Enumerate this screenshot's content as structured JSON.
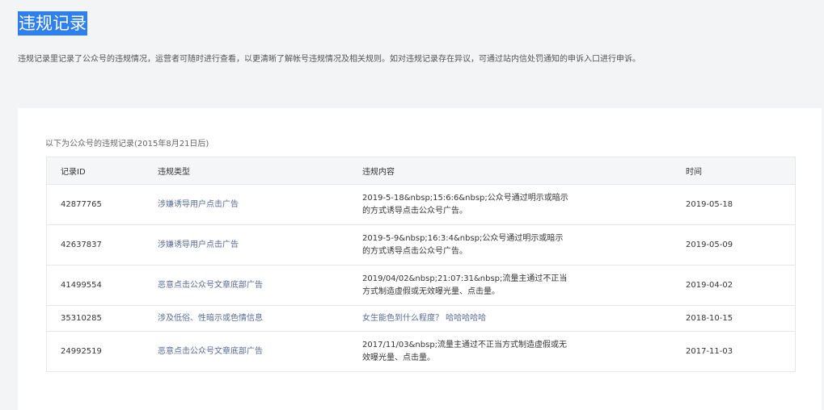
{
  "header": {
    "title": "违规记录",
    "description": "违规记录里记录了公众号的违规情况，运营者可随时进行查看，以更清晰了解帐号违规情况及相关规则。如对违规记录存在异议，可通过站内信处罚通知的申诉入口进行申诉。"
  },
  "records": {
    "caption": "以下为公众号的违规记录(2015年8月21日后)",
    "columns": {
      "id": "记录ID",
      "type": "违规类型",
      "content": "违规内容",
      "time": "时间"
    },
    "rows": [
      {
        "id": "42877765",
        "type": "涉嫌诱导用户点击广告",
        "content": "2019-5-18&nbsp;15:6:6&nbsp;公众号通过明示或暗示的方式诱导点击公众号广告。",
        "time": "2019-05-18"
      },
      {
        "id": "42637837",
        "type": "涉嫌诱导用户点击广告",
        "content": "2019-5-9&nbsp;16:3:4&nbsp;公众号通过明示或暗示的方式诱导点击公众号广告。",
        "time": "2019-05-09"
      },
      {
        "id": "41499554",
        "type": "恶意点击公众号文章底部广告",
        "content": "2019/04/02&nbsp;21:07:31&nbsp;流量主通过不正当方式制造虚假或无效曝光量、点击量。",
        "time": "2019-04-02"
      },
      {
        "id": "35310285",
        "type": "涉及低俗、性暗示或色情信息",
        "content": "女生能色到什么程度？ 哈哈哈哈哈",
        "time": "2018-10-15"
      },
      {
        "id": "24992519",
        "type": "恶意点击公众号文章底部广告",
        "content": "2017/11/03&nbsp;流量主通过不正当方式制造虚假或无效曝光量、点击量。",
        "time": "2017-11-03"
      }
    ]
  },
  "colors": {
    "title_highlight": "#2f80ed",
    "link": "#576b95"
  }
}
